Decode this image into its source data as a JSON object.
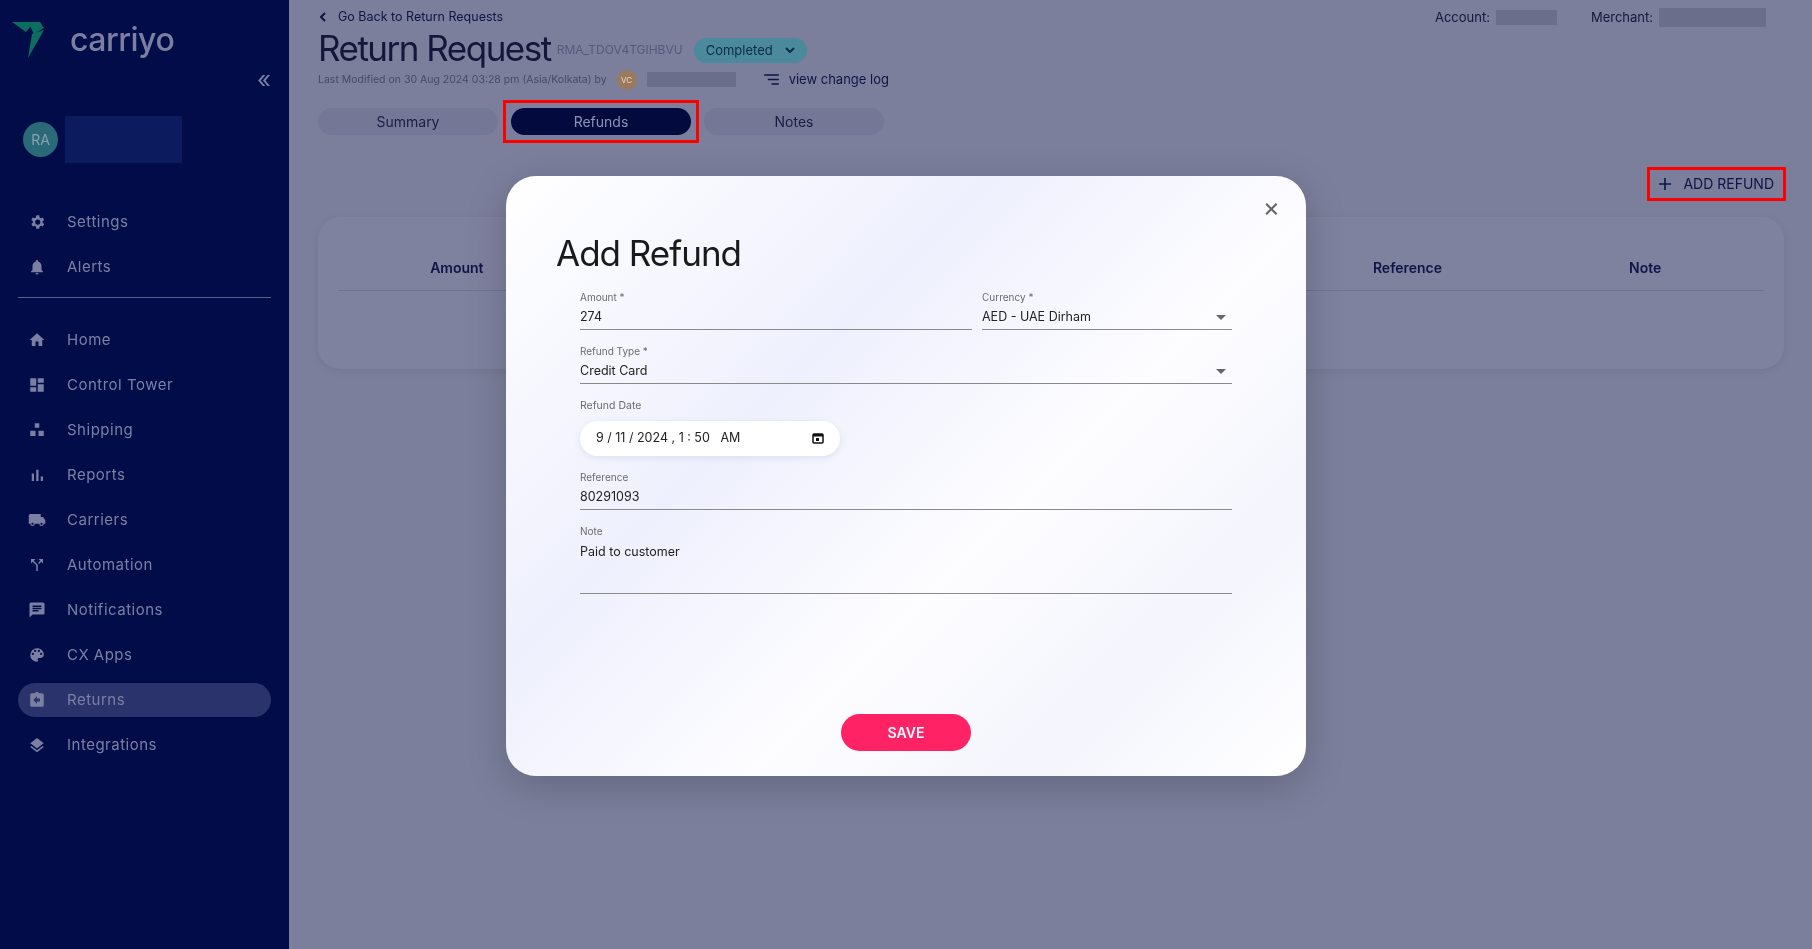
{
  "sidebar": {
    "logo": "carriyo",
    "collapse": "«",
    "user": {
      "initials": "RA"
    },
    "top_items": [
      {
        "label": "Settings",
        "selected": false
      },
      {
        "label": "Alerts",
        "selected": false
      }
    ],
    "items": [
      {
        "label": "Home",
        "selected": false
      },
      {
        "label": "Control Tower",
        "selected": false
      },
      {
        "label": "Shipping",
        "selected": false
      },
      {
        "label": "Reports",
        "selected": false
      },
      {
        "label": "Carriers",
        "selected": false
      },
      {
        "label": "Automation",
        "selected": false
      },
      {
        "label": "Notifications",
        "selected": false
      },
      {
        "label": "CX Apps",
        "selected": false
      },
      {
        "label": "Returns",
        "selected": true
      },
      {
        "label": "Integrations",
        "selected": false
      }
    ]
  },
  "header": {
    "back_link": "Go Back to Return Requests",
    "title": "Return Request",
    "id": "RMA_TDOV4TGIHBVU",
    "status": "Completed",
    "last_modified": "Last Modified on 30 Aug 2024 03:28 pm (Asia/Kolkata) by",
    "modifier_initials": "VC",
    "change_log": "view change log",
    "account_label": "Account:",
    "merchant_label": "Merchant:"
  },
  "tabs": [
    {
      "label": "Summary",
      "selected": false,
      "highlighted": false
    },
    {
      "label": "Refunds",
      "selected": true,
      "highlighted": true
    },
    {
      "label": "Notes",
      "selected": false,
      "highlighted": false
    }
  ],
  "add_refund": {
    "label": "ADD REFUND",
    "highlighted": true
  },
  "table": {
    "columns": [
      {
        "label": "Amount"
      },
      {
        "label": "Reference"
      },
      {
        "label": "Note"
      }
    ]
  },
  "dialog": {
    "title": "Add Refund",
    "close": "×",
    "amount": {
      "label": "Amount *",
      "value": "274"
    },
    "currency": {
      "label": "Currency *",
      "value": "AED - UAE Dirham"
    },
    "refund_type": {
      "label": "Refund Type *",
      "value": "Credit Card"
    },
    "refund_date": {
      "label": "Refund Date",
      "value": "9 / 11 / 2024 , 1 : 50   AM"
    },
    "reference": {
      "label": "Reference",
      "value": "80291093"
    },
    "note": {
      "label": "Note",
      "value": "Paid to customer"
    },
    "save": "SAVE"
  }
}
